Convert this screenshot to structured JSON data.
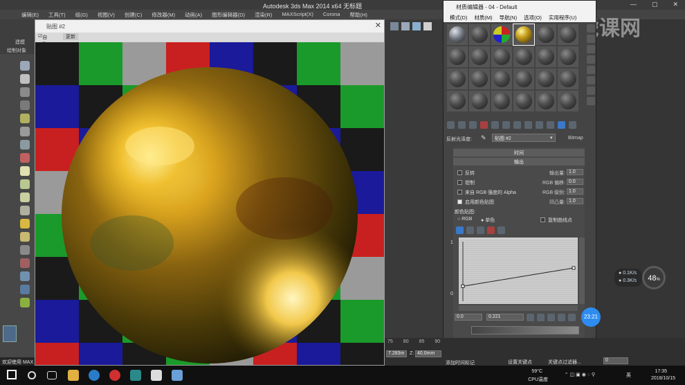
{
  "app": {
    "title": "Autodesk 3ds Max  2014 x64     无标题",
    "min": "—",
    "max": "▢",
    "close": "✕"
  },
  "menu": [
    "编辑(E)",
    "工具(T)",
    "组(G)",
    "视图(V)",
    "创建(C)",
    "修改器(M)",
    "动画(A)",
    "图形编辑器(D)",
    "渲染(R)",
    "MAXScript(X)",
    "Corona",
    "帮助(H)"
  ],
  "left": {
    "label_a": "建模",
    "label_b": "绘制对象",
    "bottom": "欢迎使用 MAX"
  },
  "map_window": {
    "title": "贴图 #2",
    "auto": "自动",
    "update": "更新",
    "close": "✕"
  },
  "mat_editor": {
    "title": "材质编辑器 - 04 - Default",
    "menu": [
      "模式(D)",
      "材质(M)",
      "导航(N)",
      "选项(O)",
      "实用程序(U)"
    ],
    "reflect_label": "反射光泽度:",
    "map_name": "贴图 #2",
    "map_type": "Bitmap",
    "rollout_time": "时间",
    "rollout_output": "输出",
    "invert": "反转",
    "clamp": "钳制",
    "alpha_from_rgb": "来自 RGB 强度的 Alpha",
    "enable_color_map": "启用颜色贴图",
    "output_amount_lbl": "输出量:",
    "output_amount": "1.0",
    "rgb_offset_lbl": "RGB 偏移:",
    "rgb_offset": "0.0",
    "rgb_level_lbl": "RGB 级别:",
    "rgb_level": "1.0",
    "bump_amount_lbl": "凹凸量:",
    "bump_amount": "1.0",
    "color_map_lbl": "颜色贴图:",
    "rgb": "RGB",
    "mono": "单色",
    "copy_curve": "复制曲线点",
    "curve_y1": "1",
    "curve_y0": "0",
    "status_x": "0.0",
    "status_y": "0.221",
    "curve_points": [
      [
        0,
        0.221
      ],
      [
        1,
        0.55
      ]
    ]
  },
  "overlay": {
    "net_up": "0.1",
    "net_up_unit": "K/s",
    "net_down": "0.3",
    "net_down_unit": "K/s",
    "cpu": "48",
    "cpu_unit": "%",
    "timer": "23:21",
    "watermark": "虎课网"
  },
  "max_status": {
    "timeline": [
      "75",
      "80",
      "85",
      "90"
    ],
    "x_field": "7.283m",
    "z_label": "Z:",
    "z_field": "40.0mm",
    "add_tag": "添加时间标记",
    "set_key": "设置关键点",
    "key_filter": "关键点过滤器...",
    "frame": "0"
  },
  "taskbar": {
    "temp": "59°C",
    "temp_label": "CPU温度",
    "lang": "英",
    "time": "17:35",
    "date": "2018/10/15"
  }
}
